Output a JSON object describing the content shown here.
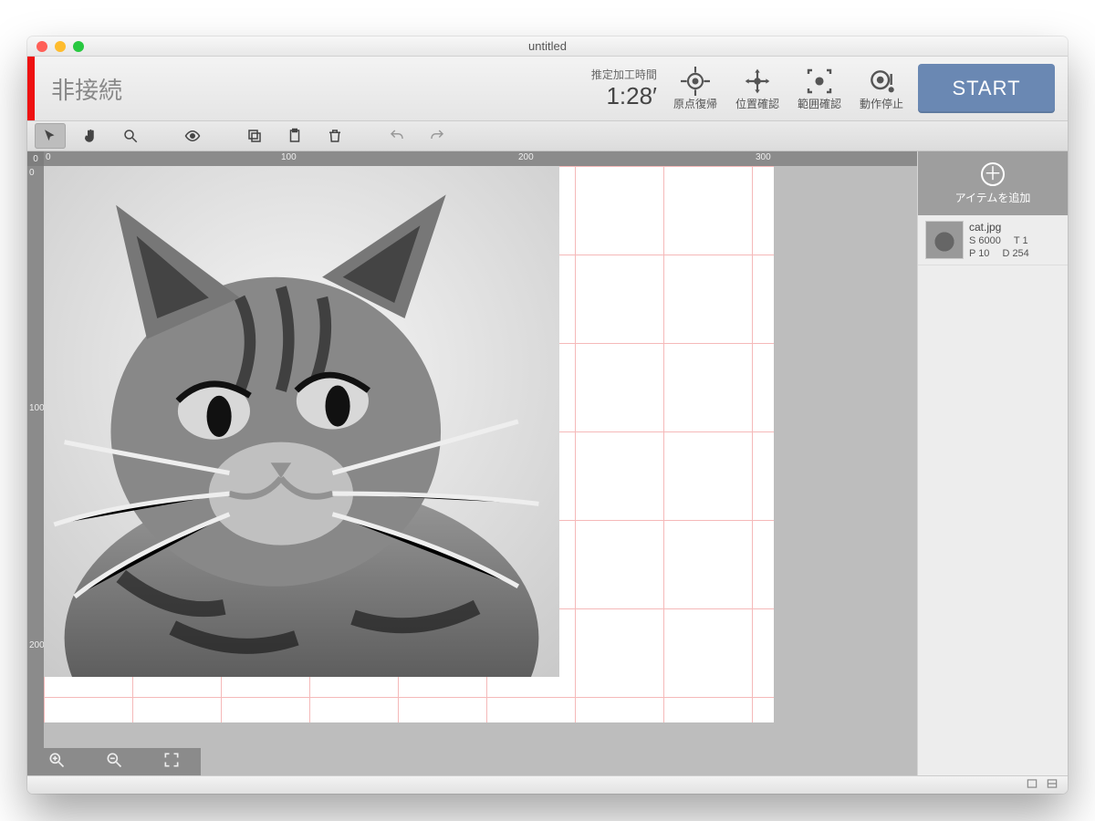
{
  "window": {
    "title": "untitled"
  },
  "header": {
    "connection_status": "非接続",
    "time_label": "推定加工時間",
    "time_value": "1:28′",
    "buttons": {
      "return_origin": "原点復帰",
      "check_position": "位置確認",
      "check_range": "範囲確認",
      "stop_motion": "動作停止"
    },
    "start_label": "START"
  },
  "ruler": {
    "ticks_h": [
      "0",
      "100",
      "200",
      "300"
    ],
    "ticks_v": [
      "0",
      "100",
      "200"
    ],
    "corner": "0"
  },
  "sidebar": {
    "add_label": "アイテムを追加",
    "items": [
      {
        "filename": "cat.jpg",
        "s": "S 6000",
        "t": "T 1",
        "p": "P 10",
        "d": "D 254"
      }
    ]
  },
  "colors": {
    "accent": "#6a88b3",
    "danger": "#e11"
  }
}
